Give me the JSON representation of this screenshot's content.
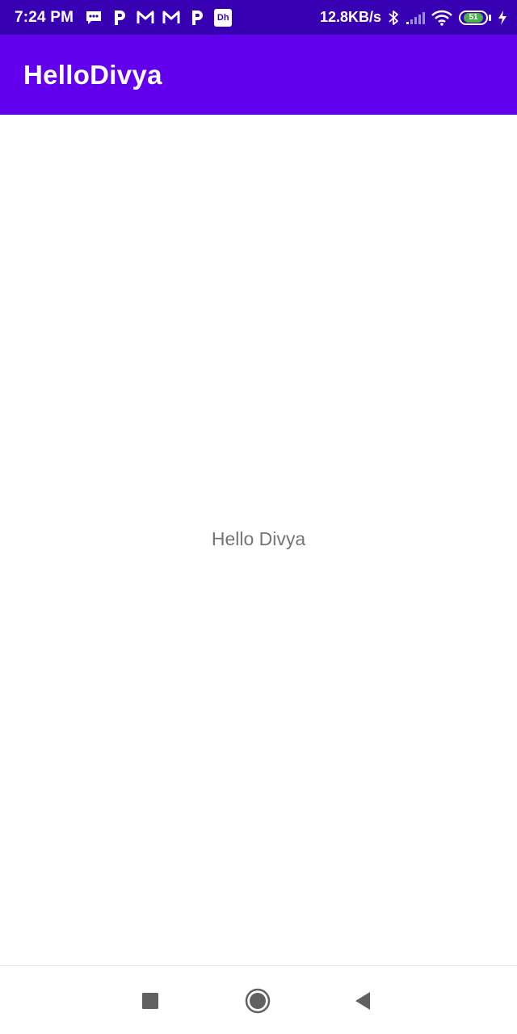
{
  "status_bar": {
    "time": "7:24 PM",
    "notification_icons": [
      "message-icon",
      "paytm-icon",
      "gmail-icon",
      "gmail-icon",
      "paytm-icon",
      "dh-app-icon"
    ],
    "dh_label": "Dh",
    "net_speed": "12.8KB/s",
    "battery_level": "51",
    "system_icons": [
      "bluetooth-icon",
      "signal-icon",
      "wifi-icon",
      "battery-icon",
      "charging-icon"
    ]
  },
  "app_bar": {
    "title": "HelloDivya",
    "color": "#6200ee"
  },
  "main": {
    "text": "Hello Divya"
  },
  "nav_bar": {
    "buttons": [
      "recents-button",
      "home-button",
      "back-button"
    ]
  },
  "colors": {
    "status_bar": "#3700b3",
    "primary": "#6200ee",
    "text_secondary": "#757575"
  }
}
